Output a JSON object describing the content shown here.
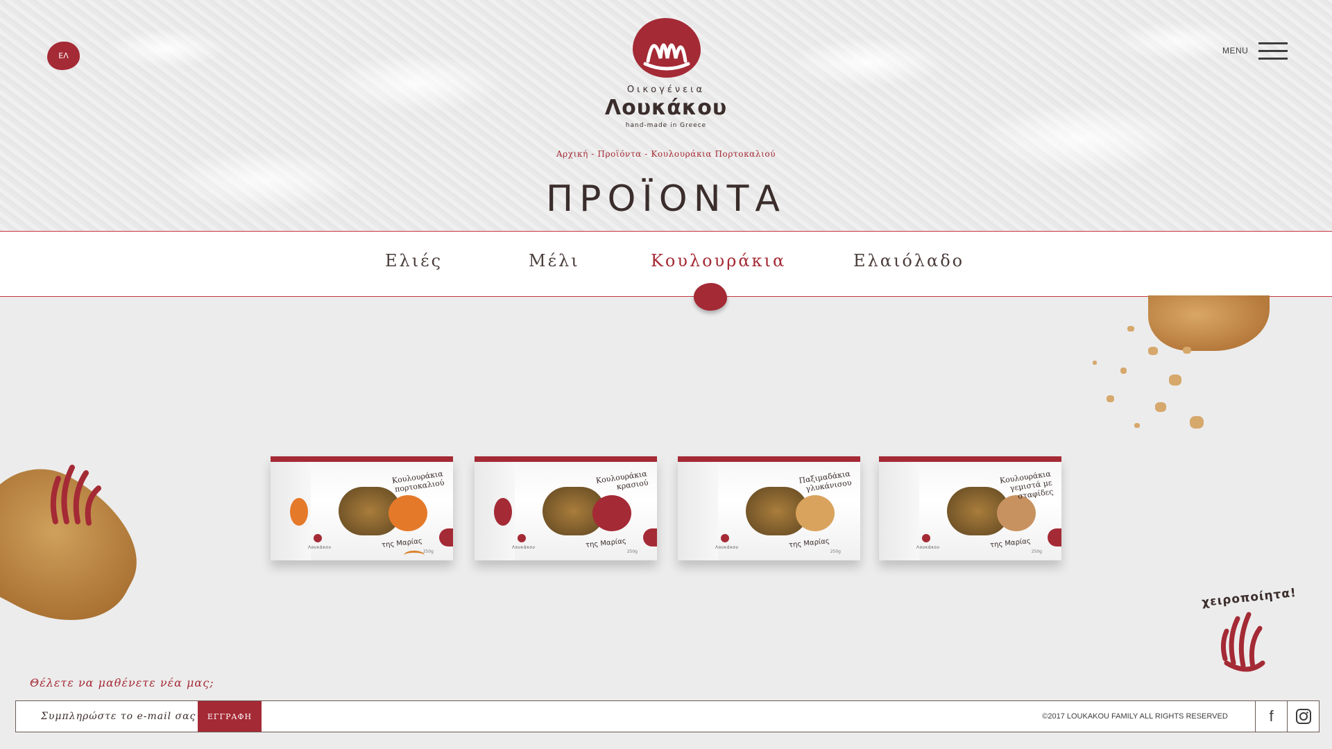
{
  "header": {
    "lang_label": "ΕΛ",
    "menu_label": "MENU",
    "logo": {
      "sub": "Οικογένεια",
      "name": "Λουκάκου",
      "tagline": "hand-made in Greece"
    },
    "breadcrumb": [
      "Αρχική",
      "Προϊόντα",
      "Κουλουράκια Πορτοκαλιού"
    ],
    "breadcrumb_sep": " - ",
    "page_title": "ΠΡΟΪΟΝΤΑ"
  },
  "categories": [
    {
      "label": "Ελιές",
      "active": false
    },
    {
      "label": "Μέλι",
      "active": false
    },
    {
      "label": "Κουλουράκια",
      "active": true
    },
    {
      "label": "Ελαιόλαδο",
      "active": false
    }
  ],
  "products": [
    {
      "label": "Κουλουράκια πορτοκαλιού",
      "fruit_color": "#e5792a",
      "maria": "της Μαρίας",
      "brand": "Λουκάκου",
      "weight": "250g"
    },
    {
      "label": "Κουλουράκια κρασιού",
      "fruit_color": "#a42a35",
      "maria": "της Μαρίας",
      "brand": "Λουκάκου",
      "weight": "250g"
    },
    {
      "label": "Παξιμαδάκια γλυκάνισου",
      "fruit_color": "#d9a35e",
      "maria": "της Μαρίας",
      "brand": "Λουκάκου",
      "weight": "250g"
    },
    {
      "label": "Κουλουράκια γεμιστά με σταφίδες",
      "fruit_color": "#c89260",
      "maria": "της Μαρίας",
      "brand": "Λουκάκου",
      "weight": "250g"
    }
  ],
  "decor": {
    "handmade_label": "χειροποίητα!"
  },
  "footer": {
    "newsletter_title": "Θέλετε να μαθένετε νέα μας;",
    "email_placeholder": "Συμπληρώστε το e-mail σας",
    "subscribe_label": "ΕΓΓΡΑΦΗ",
    "copyright": "©2017 LOUKAKOU FAMILY ALL RIGHTS RESERVED",
    "facebook_glyph": "f"
  },
  "colors": {
    "brand": "#a42a35",
    "text": "#3a2d2b"
  }
}
